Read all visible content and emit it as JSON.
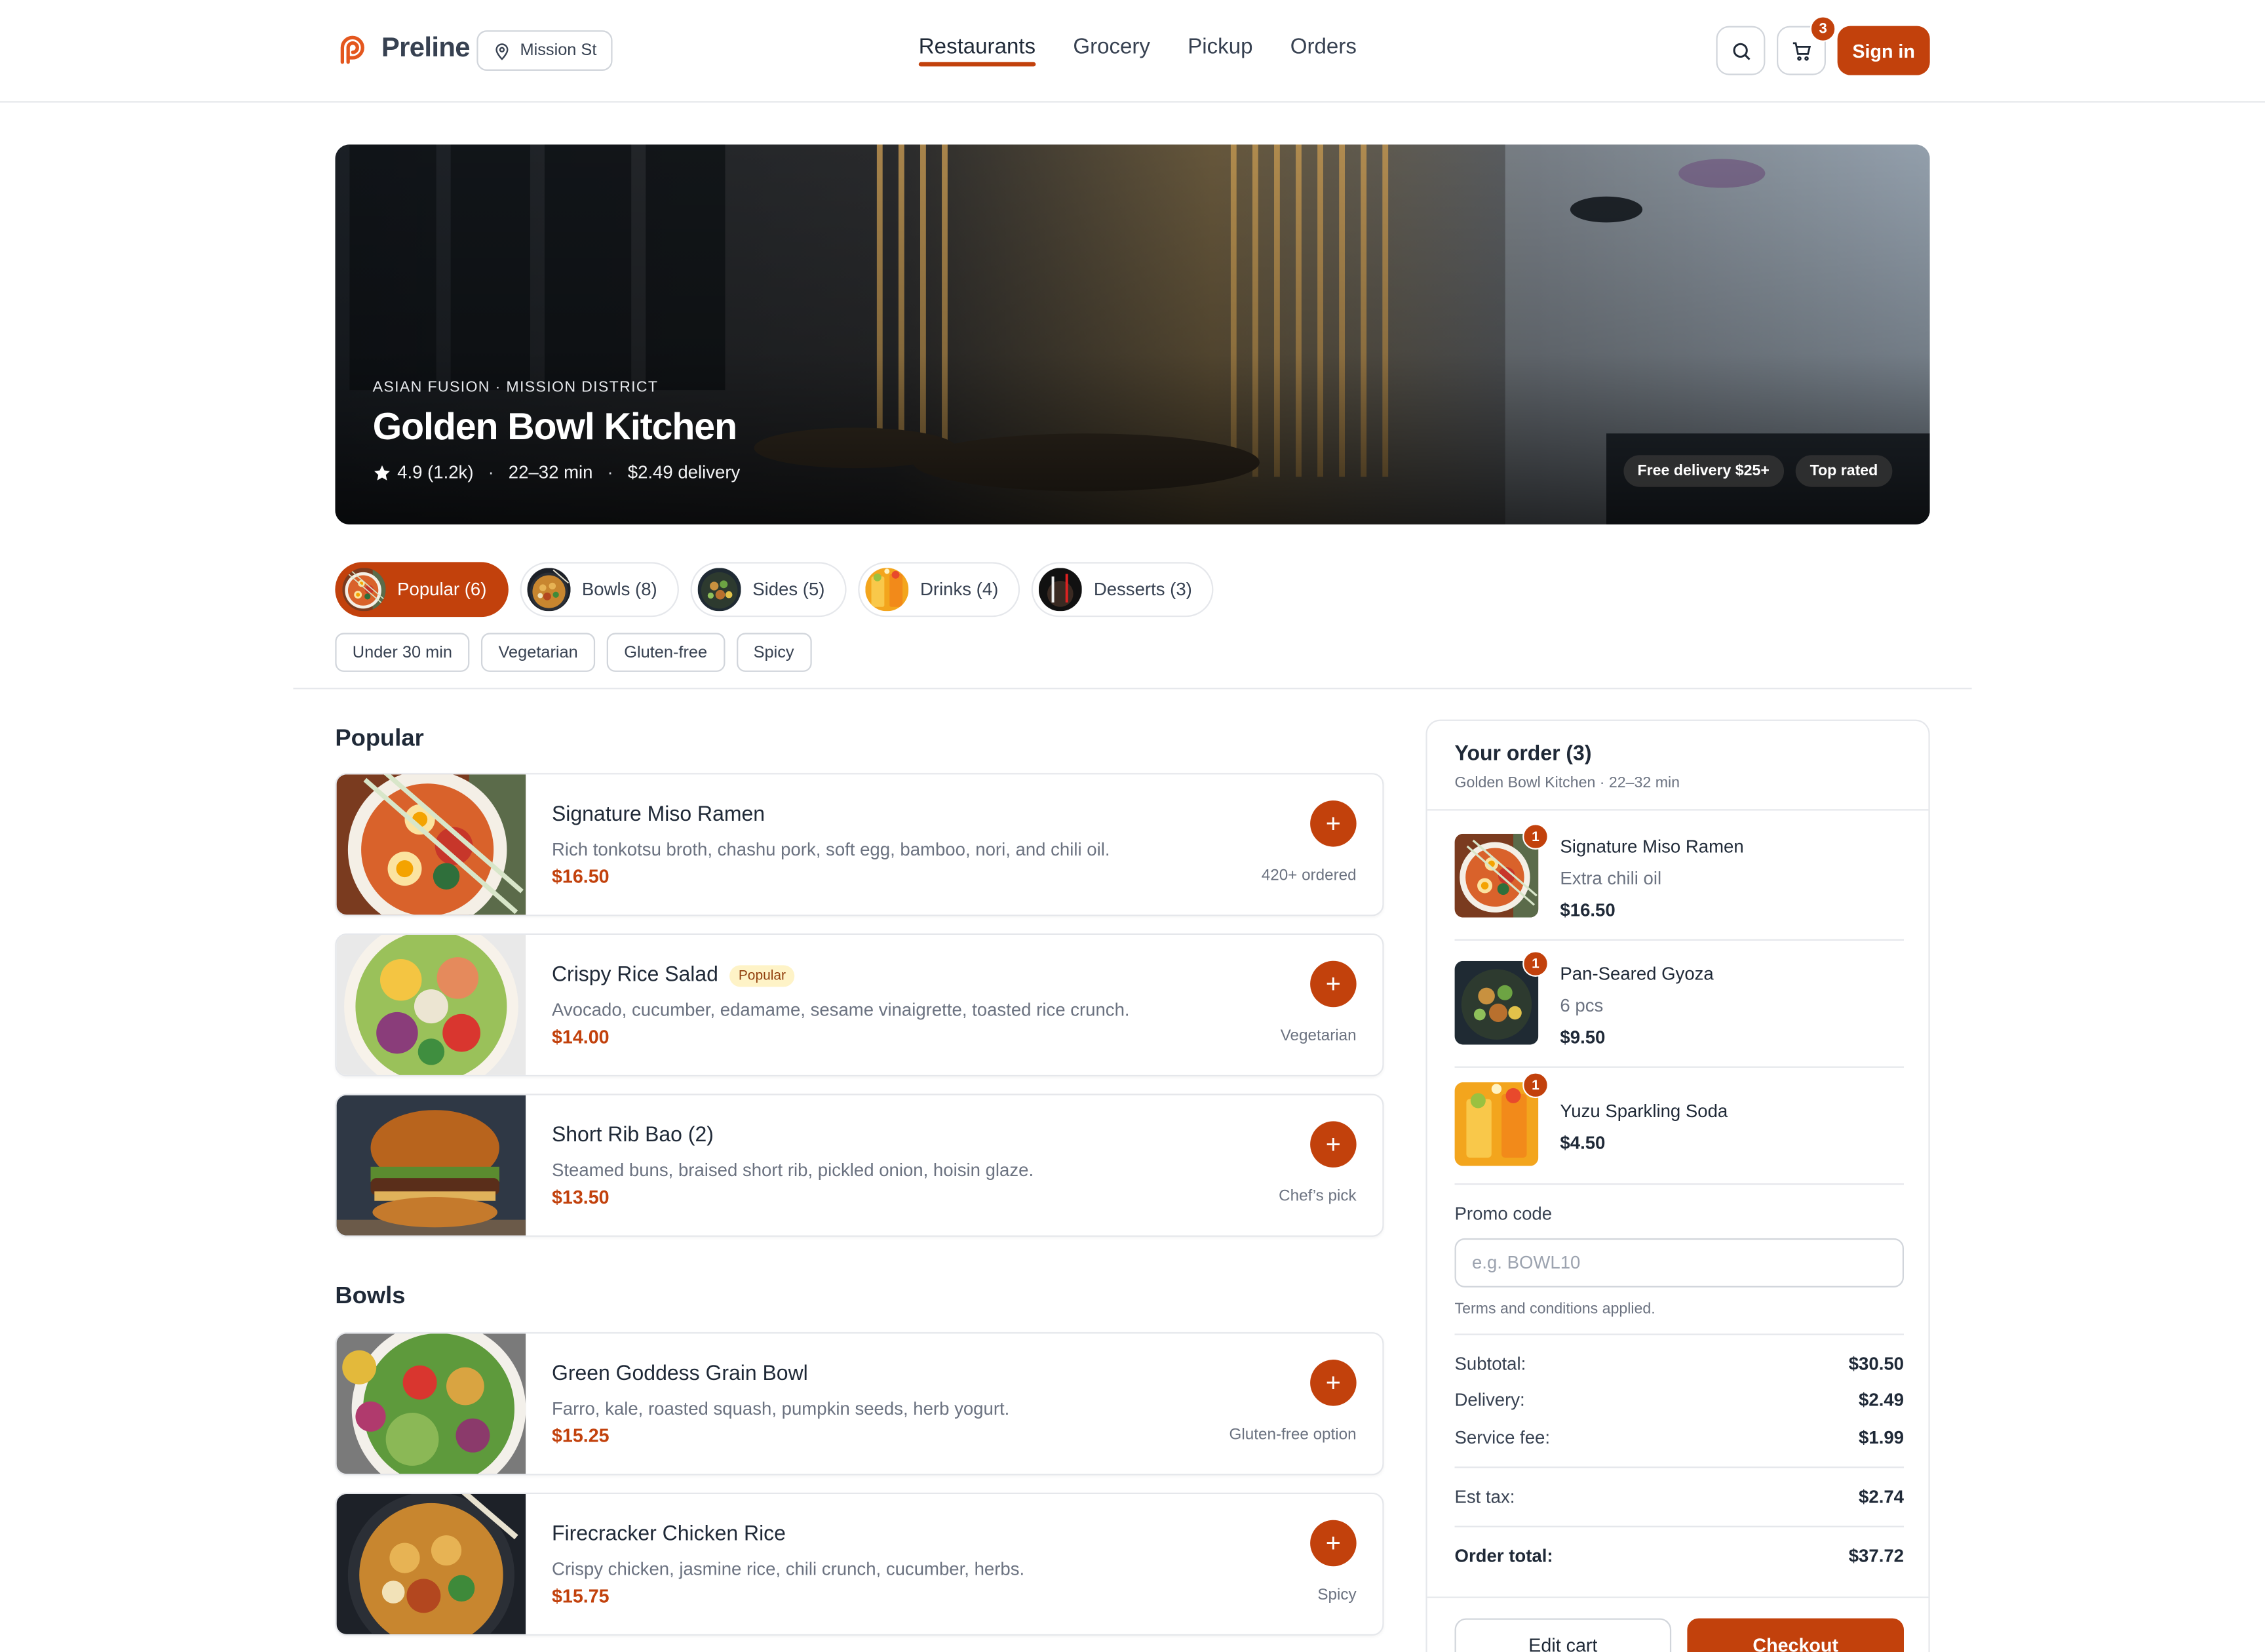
{
  "header": {
    "brand": "Preline",
    "location": "Mission St",
    "nav": [
      {
        "label": "Restaurants",
        "active": true
      },
      {
        "label": "Grocery",
        "active": false
      },
      {
        "label": "Pickup",
        "active": false
      },
      {
        "label": "Orders",
        "active": false
      }
    ],
    "cart_count": "3",
    "signin_label": "Sign in"
  },
  "hero": {
    "subtitle": "ASIAN FUSION · MISSION DISTRICT",
    "title": "Golden Bowl Kitchen",
    "rating": "4.9 (1.2k)",
    "eta": "22–32 min",
    "delivery": "$2.49 delivery",
    "tags": [
      "Free delivery $25+",
      "Top rated"
    ]
  },
  "categories": [
    {
      "label": "Popular (6)",
      "active": true,
      "icon": "ramen-thumb"
    },
    {
      "label": "Bowls (8)",
      "active": false,
      "icon": "bowl-thumb"
    },
    {
      "label": "Sides (5)",
      "active": false,
      "icon": "salad-thumb"
    },
    {
      "label": "Drinks (4)",
      "active": false,
      "icon": "drink-thumb"
    },
    {
      "label": "Desserts (3)",
      "active": false,
      "icon": "dessert-thumb"
    }
  ],
  "filters": [
    "Under 30 min",
    "Vegetarian",
    "Gluten-free",
    "Spicy"
  ],
  "sections": [
    {
      "title": "Popular",
      "items": [
        {
          "name": "Signature Miso Ramen",
          "badge": "",
          "desc": "Rich tonkotsu broth, chashu pork, soft egg, bamboo, nori, and chili oil.",
          "price": "$16.50",
          "note": "420+ ordered",
          "image": "ramen"
        },
        {
          "name": "Crispy Rice Salad",
          "badge": "Popular",
          "desc": "Avocado, cucumber, edamame, sesame vinaigrette, toasted rice crunch.",
          "price": "$14.00",
          "note": "Vegetarian",
          "image": "salad"
        },
        {
          "name": "Short Rib Bao (2)",
          "badge": "",
          "desc": "Steamed buns, braised short rib, pickled onion, hoisin glaze.",
          "price": "$13.50",
          "note": "Chef’s pick",
          "image": "burger"
        }
      ]
    },
    {
      "title": "Bowls",
      "items": [
        {
          "name": "Green Goddess Grain Bowl",
          "badge": "",
          "desc": "Farro, kale, roasted squash, pumpkin seeds, herb yogurt.",
          "price": "$15.25",
          "note": "Gluten-free option",
          "image": "greenbowl"
        },
        {
          "name": "Firecracker Chicken Rice",
          "badge": "",
          "desc": "Crispy chicken, jasmine rice, chili crunch, cucumber, herbs.",
          "price": "$15.75",
          "note": "Spicy",
          "image": "chickenrice"
        }
      ]
    }
  ],
  "order": {
    "title": "Your order (3)",
    "subtitle": "Golden Bowl Kitchen · 22–32 min",
    "lines": [
      {
        "qty": "1",
        "name": "Signature Miso Ramen",
        "option": "Extra chili oil",
        "price": "$16.50",
        "image": "ramen"
      },
      {
        "qty": "1",
        "name": "Pan-Seared Gyoza",
        "option": "6 pcs",
        "price": "$9.50",
        "image": "gyoza"
      },
      {
        "qty": "1",
        "name": "Yuzu Sparkling Soda",
        "option": "",
        "price": "$4.50",
        "image": "soda"
      }
    ],
    "promo_label": "Promo code",
    "promo_placeholder": "e.g. BOWL10",
    "promo_note": "Terms and conditions applied.",
    "subtotal_label": "Subtotal:",
    "subtotal": "$30.50",
    "delivery_label": "Delivery:",
    "delivery": "$2.49",
    "service_label": "Service fee:",
    "service": "$1.99",
    "tax_label": "Est tax:",
    "tax": "$2.74",
    "total_label": "Order total:",
    "total": "$37.72",
    "edit_label": "Edit cart",
    "checkout_label": "Checkout"
  },
  "colors": {
    "accent": "#c2410c",
    "text": "#1f2937",
    "muted": "#6b7280",
    "border": "#e5e7eb"
  }
}
